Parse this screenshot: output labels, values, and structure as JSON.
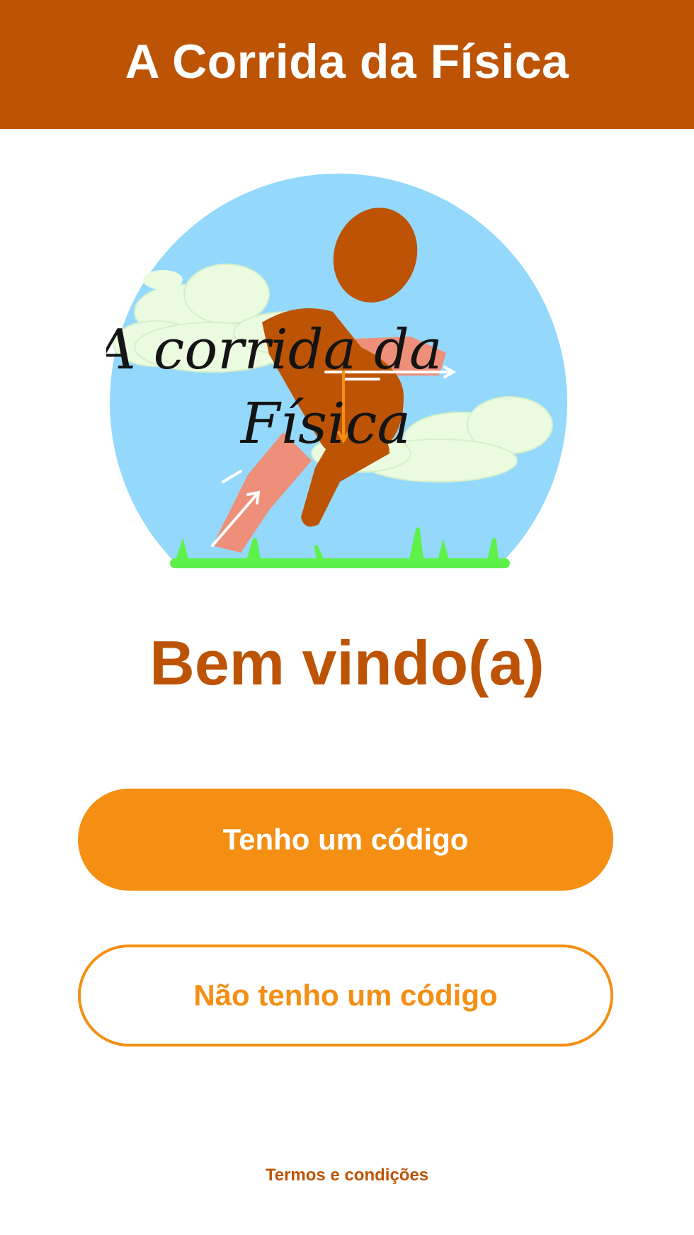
{
  "header": {
    "title": "A Corrida da Física"
  },
  "logo": {
    "line1": "A corrida da",
    "line2": "Física"
  },
  "welcome": {
    "text": "Bem vindo(a)"
  },
  "buttons": {
    "has_code": "Tenho um código",
    "no_code": "Não tenho um código"
  },
  "footer": {
    "terms": "Termos e condições"
  },
  "colors": {
    "header_bg": "#bd5405",
    "accent": "#f48f14",
    "sky": "#94d9fb",
    "grass": "#5ef14a",
    "runner": "#bd5405",
    "runner_limb": "#ee8f79"
  }
}
